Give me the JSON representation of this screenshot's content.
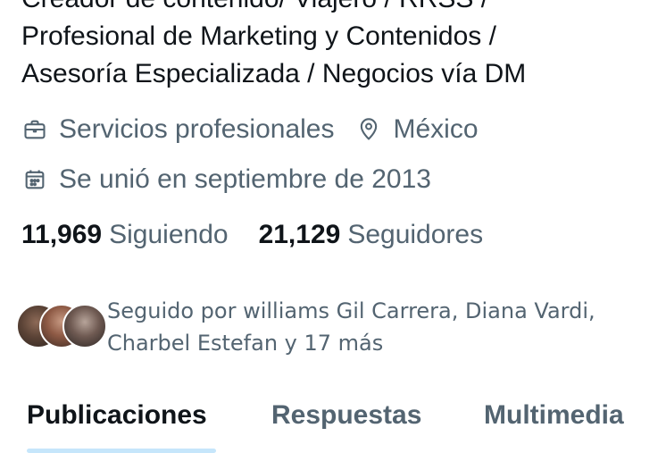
{
  "profile": {
    "bio": "Creador de contenido/ Viajero / RRSS /\nProfesional de Marketing y Contenidos /\nAsesoría Especializada / Negocios vía DM",
    "category": "Servicios profesionales",
    "location": "México",
    "joined": "Se unió en septiembre de 2013"
  },
  "stats": {
    "following_count": "11,969",
    "following_label": "Siguiendo",
    "followers_count": "21,129",
    "followers_label": "Seguidores"
  },
  "followed_by": {
    "text": "Seguido por williams Gil Carrera, Diana Vardi,\nCharbel Estefan y 17 más"
  },
  "tabs": [
    {
      "label": "Publicaciones",
      "active": true
    },
    {
      "label": "Respuestas",
      "active": false
    },
    {
      "label": "Multimedia",
      "active": false
    }
  ],
  "icons": {
    "category": "briefcase-icon",
    "location": "location-pin-icon",
    "joined": "calendar-icon"
  },
  "colors": {
    "text_primary": "#0f1419",
    "text_secondary": "#536471",
    "accent": "#1d9bf0"
  }
}
